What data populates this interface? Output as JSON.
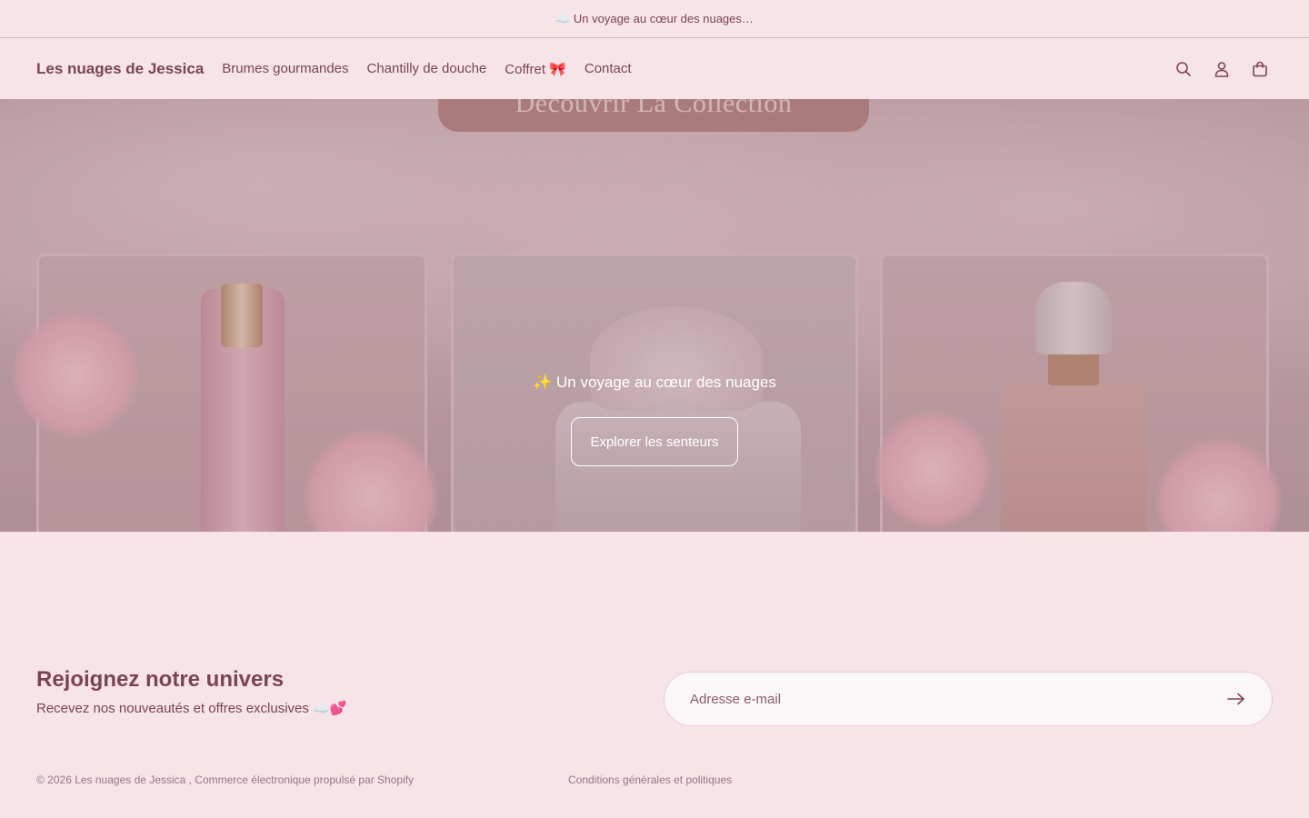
{
  "announcement": {
    "text": "☁️ Un voyage au cœur des nuages…"
  },
  "header": {
    "logo": "Les nuages de Jessica",
    "nav": [
      {
        "label": "Brumes gourmandes"
      },
      {
        "label": "Chantilly de douche"
      },
      {
        "label": "Coffret 🎀"
      },
      {
        "label": "Contact"
      }
    ],
    "icons": [
      "search-icon",
      "account-icon",
      "cart-icon"
    ]
  },
  "hero": {
    "banner_text": "Découvrir La Collection",
    "tagline": "✨ Un voyage au cœur des nuages",
    "button_label": "Explorer les senteurs"
  },
  "newsletter": {
    "title": "Rejoignez notre univers",
    "subtitle": "Recevez nos nouveautés et offres exclusives ☁️💕",
    "email_placeholder": "Adresse e-mail"
  },
  "footer": {
    "copyright": "© 2026 Les nuages de Jessica , Commerce électronique propulsé par Shopify",
    "policy_link": "Conditions générales et politiques"
  },
  "colors": {
    "background": "#f7e4e9",
    "text": "#7a4552"
  }
}
